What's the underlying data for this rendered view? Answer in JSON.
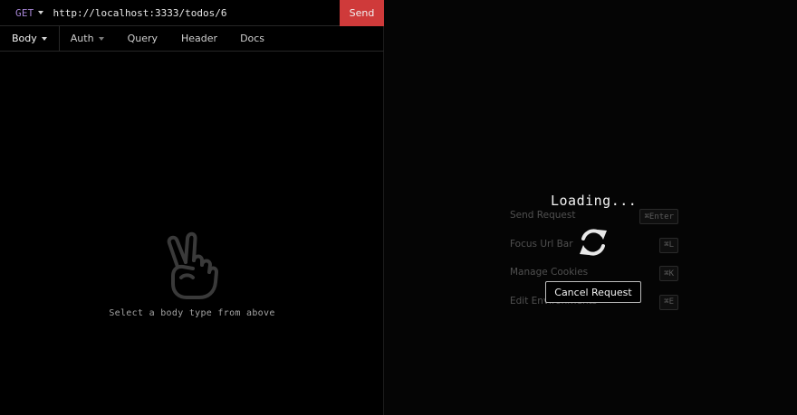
{
  "request": {
    "method": "GET",
    "url": "http://localhost:3333/todos/6",
    "send_label": "Send"
  },
  "tabs": [
    {
      "label": "Body",
      "active": true,
      "dropdown": true
    },
    {
      "label": "Auth",
      "dropdown": true
    },
    {
      "label": "Query"
    },
    {
      "label": "Header"
    },
    {
      "label": "Docs"
    }
  ],
  "body_panel": {
    "icon": "peace-hand-icon",
    "empty_message": "Select a body type from above"
  },
  "response_panel": {
    "loading_title": "Loading...",
    "loading_icon": "refresh-icon",
    "cancel_label": "Cancel Request",
    "shortcuts": [
      {
        "label": "Send Request",
        "key": "⌘Enter"
      },
      {
        "label": "Focus Url Bar",
        "key": "⌘L"
      },
      {
        "label": "Manage Cookies",
        "key": "⌘K"
      },
      {
        "label": "Edit Environments",
        "key": "⌘E"
      }
    ]
  },
  "colors": {
    "accent_send": "#cf3a3a",
    "method_get": "#a786d6",
    "background": "#000000"
  }
}
